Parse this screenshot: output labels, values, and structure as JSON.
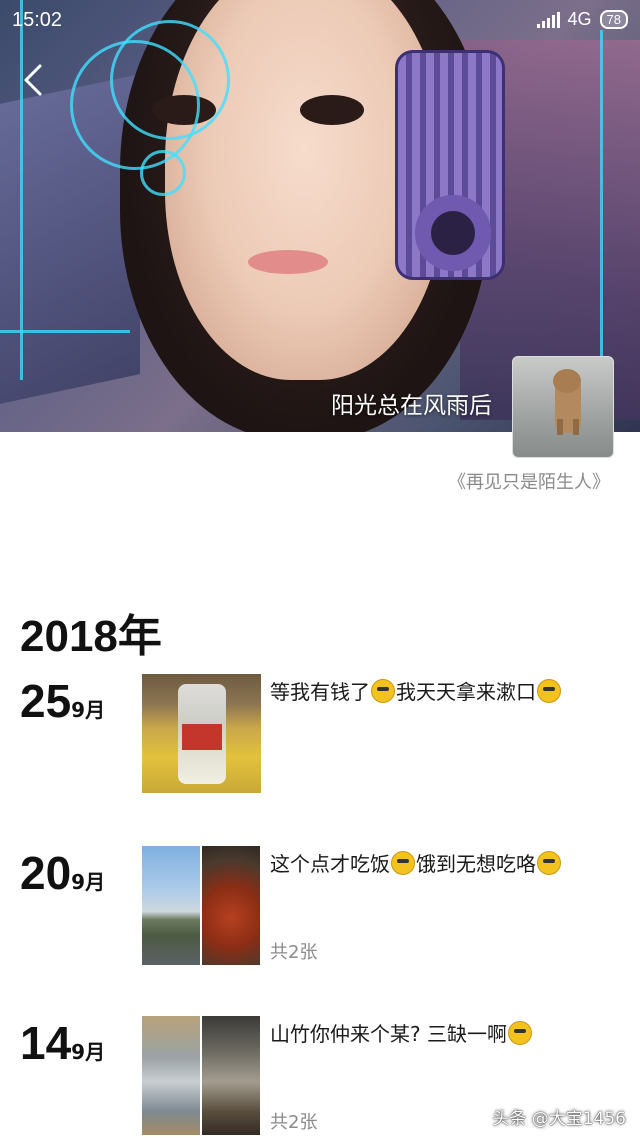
{
  "status_bar": {
    "time": "15:02",
    "network": "4G",
    "battery": "78"
  },
  "profile": {
    "name": "阳光总在风雨后",
    "signature": "《再见只是陌生人》"
  },
  "timeline": {
    "year": "2018年",
    "entries": [
      {
        "day": "25",
        "month": "9月",
        "text_parts": [
          "等我有钱了",
          "我天天拿来漱口",
          ""
        ],
        "emojis": [
          "cool-face-emoji",
          "confused-face-emoji"
        ],
        "image_count": ""
      },
      {
        "day": "20",
        "month": "9月",
        "text_parts": [
          "这个点才吃饭",
          "饿到无想吃咯",
          ""
        ],
        "emojis": [
          "dizzy-face-emoji",
          "surprised-face-emoji"
        ],
        "image_count": "共2张"
      },
      {
        "day": "14",
        "month": "9月",
        "text_parts": [
          "山竹你仲来个某? 三缺一啊",
          ""
        ],
        "emojis": [
          "smirk-face-emoji"
        ],
        "image_count": "共2张"
      }
    ]
  },
  "watermark": "头条 @大宝1456"
}
